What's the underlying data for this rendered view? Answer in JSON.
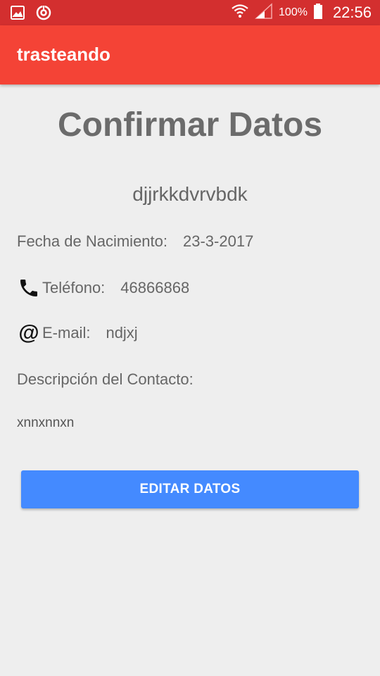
{
  "status_bar": {
    "left_icons": [
      "gallery-icon",
      "sync-icon"
    ],
    "right_icons": [
      "wifi-icon",
      "signal-icon",
      "battery-icon"
    ],
    "battery_percent": "100%",
    "time": "22:56"
  },
  "app_bar": {
    "title": "trasteando"
  },
  "content": {
    "page_title": "Confirmar Datos",
    "contact_name": "djjrkkdvrvbdk",
    "birth_label": "Fecha de Nacimiento:",
    "birth_value": "23-3-2017",
    "phone_label": "Teléfono:",
    "phone_value": "46866868",
    "phone_icon": "phone-icon",
    "email_label": "E-mail:",
    "email_value": "ndjxj",
    "email_icon": "at-sign-icon",
    "description_label": "Descripción del Contacto:",
    "description_value": "xnnxnnxn"
  },
  "actions": {
    "edit_label": "EDITAR DATOS"
  },
  "colors": {
    "status_bar": "#d32f2f",
    "app_bar": "#f44336",
    "background": "#eeeeee",
    "button": "#448aff"
  }
}
